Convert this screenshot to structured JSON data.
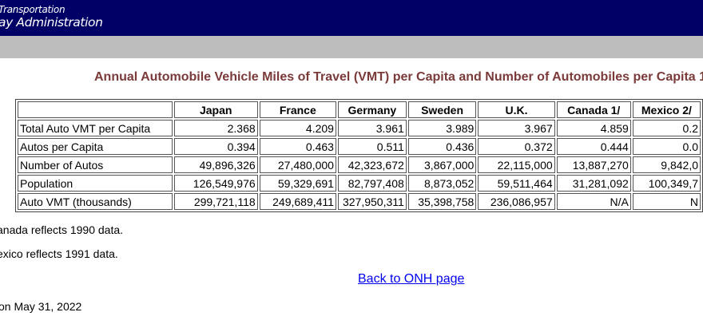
{
  "header": {
    "agency_line1": "Transportation",
    "agency_line2": "ay Administration",
    "background": "#000066",
    "nav_bar_color": "#bdbdbd"
  },
  "title": "Annual Automobile Vehicle Miles of Travel (VMT) per Capita and Number of Automobiles per Capita 1",
  "title_color": "#7a3a3a",
  "table": {
    "columns": [
      "",
      "Japan",
      "France",
      "Germany",
      "Sweden",
      "U.K.",
      "Canada 1/",
      "Mexico 2/"
    ],
    "rows": [
      {
        "label": "Total Auto VMT per Capita",
        "values": [
          "2.368",
          "4.209",
          "3.961",
          "3.989",
          "3.967",
          "4.859",
          "0.2"
        ]
      },
      {
        "label": "Autos per Capita",
        "values": [
          "0.394",
          "0.463",
          "0.511",
          "0.436",
          "0.372",
          "0.444",
          "0.0"
        ]
      },
      {
        "label": "Number of Autos",
        "values": [
          "49,896,326",
          "27,480,000",
          "42,323,672",
          "3,867,000",
          "22,115,000",
          "13,887,270",
          "9,842,0"
        ]
      },
      {
        "label": "Population",
        "values": [
          "126,549,976",
          "59,329,691",
          "82,797,408",
          "8,873,052",
          "59,511,464",
          "31,281,092",
          "100,349,7"
        ]
      },
      {
        "label": "Auto VMT (thousands)",
        "values": [
          "299,721,118",
          "249,689,411",
          "327,950,311",
          "35,398,758",
          "236,086,957",
          "N/A",
          "N"
        ]
      }
    ]
  },
  "notes": [
    "anada reflects 1990 data.",
    "exico reflects 1991 data."
  ],
  "back_link": "Back to ONH page",
  "link_color": "#0000ee",
  "updated": "on May 31, 2022"
}
